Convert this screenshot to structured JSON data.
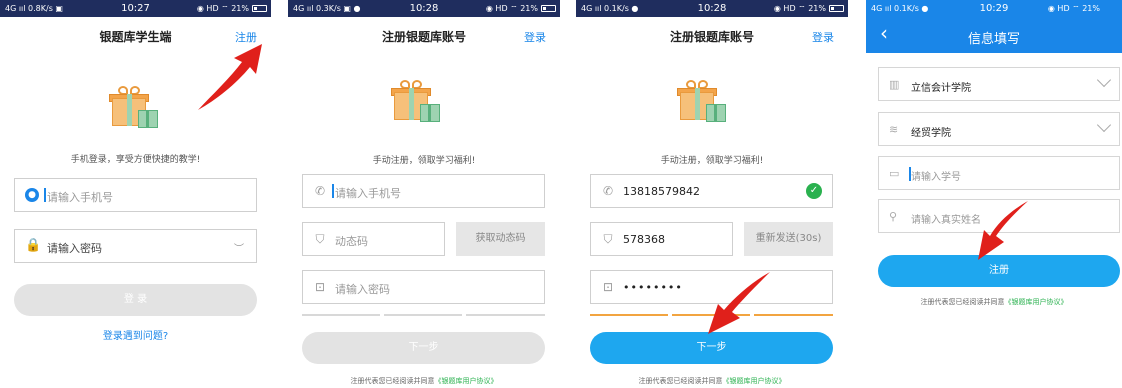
{
  "status": {
    "s1": {
      "left": "4G ııl 0.8K/s ▣",
      "time": "10:27",
      "right": "◉ HD ⌔ 21%"
    },
    "s2": {
      "left": "4G ııl 0.3K/s ▣ ●",
      "time": "10:28",
      "right": "◉ HD ⌔ 21%"
    },
    "s3": {
      "left": "4G ııl 0.1K/s ●",
      "time": "10:28",
      "right": "◉ HD ⌔ 21%"
    },
    "s4": {
      "left": "4G ııl 0.1K/s ●",
      "time": "10:29",
      "right": "◉ HD ⌔ 21%"
    }
  },
  "login": {
    "title": "银题库学生端",
    "register_link": "注册",
    "tagline": "手机登录，享受方便快捷的教学!",
    "phone_placeholder": "请输入手机号",
    "password_placeholder": "请输入密码",
    "login_button": "登 录",
    "help_link": "登录遇到问题?"
  },
  "register": {
    "title": "注册银题库账号",
    "login_link": "登录",
    "tagline": "手动注册，领取学习福利!",
    "phone_placeholder": "请输入手机号",
    "code_placeholder": "动态码",
    "get_code_button": "获取动态码",
    "password_placeholder": "请输入密码",
    "next_button": "下一步",
    "agreement_prefix": "注册代表您已经阅读并同意",
    "agreement_link": "《银题库用户协议》"
  },
  "register_filled": {
    "title": "注册银题库账号",
    "login_link": "登录",
    "tagline": "手动注册，领取学习福利!",
    "phone_value": "13818579842",
    "code_value": "578368",
    "resend_button": "重新发送(30s)",
    "password_value": "••••••••",
    "next_button": "下一步",
    "agreement_prefix": "注册代表您已经阅读并同意",
    "agreement_link": "《银题库用户协议》"
  },
  "info": {
    "title": "信息填写",
    "back": "‹",
    "school_value": "立信会计学院",
    "college_value": "经贸学院",
    "student_id_placeholder": "请输入学号",
    "name_placeholder": "请输入真实姓名",
    "register_button": "注册",
    "agreement_prefix": "注册代表您已经阅读并同意",
    "agreement_link": "《银题库用户协议》"
  },
  "colors": {
    "primary": "#1a86e8",
    "button_blue": "#1ea7ef",
    "annotation_red": "#e0201b",
    "success_green": "#2ab14f"
  }
}
